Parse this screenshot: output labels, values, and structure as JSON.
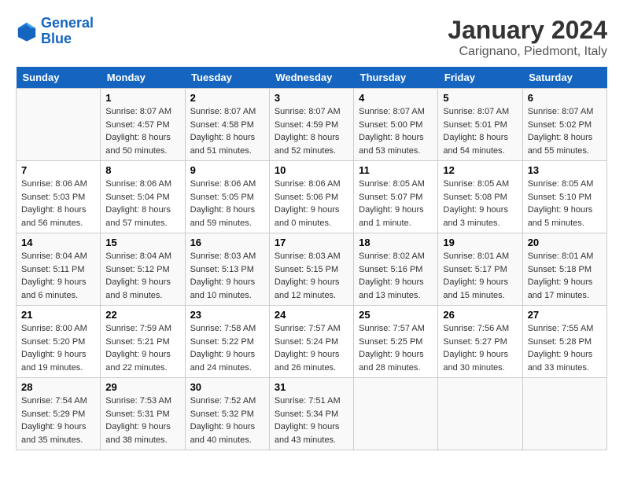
{
  "logo": {
    "line1": "General",
    "line2": "Blue"
  },
  "title": "January 2024",
  "subtitle": "Carignano, Piedmont, Italy",
  "days_of_week": [
    "Sunday",
    "Monday",
    "Tuesday",
    "Wednesday",
    "Thursday",
    "Friday",
    "Saturday"
  ],
  "weeks": [
    [
      {
        "day": "",
        "sunrise": "",
        "sunset": "",
        "daylight": "",
        "empty": true
      },
      {
        "day": "1",
        "sunrise": "Sunrise: 8:07 AM",
        "sunset": "Sunset: 4:57 PM",
        "daylight": "Daylight: 8 hours and 50 minutes."
      },
      {
        "day": "2",
        "sunrise": "Sunrise: 8:07 AM",
        "sunset": "Sunset: 4:58 PM",
        "daylight": "Daylight: 8 hours and 51 minutes."
      },
      {
        "day": "3",
        "sunrise": "Sunrise: 8:07 AM",
        "sunset": "Sunset: 4:59 PM",
        "daylight": "Daylight: 8 hours and 52 minutes."
      },
      {
        "day": "4",
        "sunrise": "Sunrise: 8:07 AM",
        "sunset": "Sunset: 5:00 PM",
        "daylight": "Daylight: 8 hours and 53 minutes."
      },
      {
        "day": "5",
        "sunrise": "Sunrise: 8:07 AM",
        "sunset": "Sunset: 5:01 PM",
        "daylight": "Daylight: 8 hours and 54 minutes."
      },
      {
        "day": "6",
        "sunrise": "Sunrise: 8:07 AM",
        "sunset": "Sunset: 5:02 PM",
        "daylight": "Daylight: 8 hours and 55 minutes."
      }
    ],
    [
      {
        "day": "7",
        "sunrise": "Sunrise: 8:06 AM",
        "sunset": "Sunset: 5:03 PM",
        "daylight": "Daylight: 8 hours and 56 minutes."
      },
      {
        "day": "8",
        "sunrise": "Sunrise: 8:06 AM",
        "sunset": "Sunset: 5:04 PM",
        "daylight": "Daylight: 8 hours and 57 minutes."
      },
      {
        "day": "9",
        "sunrise": "Sunrise: 8:06 AM",
        "sunset": "Sunset: 5:05 PM",
        "daylight": "Daylight: 8 hours and 59 minutes."
      },
      {
        "day": "10",
        "sunrise": "Sunrise: 8:06 AM",
        "sunset": "Sunset: 5:06 PM",
        "daylight": "Daylight: 9 hours and 0 minutes."
      },
      {
        "day": "11",
        "sunrise": "Sunrise: 8:05 AM",
        "sunset": "Sunset: 5:07 PM",
        "daylight": "Daylight: 9 hours and 1 minute."
      },
      {
        "day": "12",
        "sunrise": "Sunrise: 8:05 AM",
        "sunset": "Sunset: 5:08 PM",
        "daylight": "Daylight: 9 hours and 3 minutes."
      },
      {
        "day": "13",
        "sunrise": "Sunrise: 8:05 AM",
        "sunset": "Sunset: 5:10 PM",
        "daylight": "Daylight: 9 hours and 5 minutes."
      }
    ],
    [
      {
        "day": "14",
        "sunrise": "Sunrise: 8:04 AM",
        "sunset": "Sunset: 5:11 PM",
        "daylight": "Daylight: 9 hours and 6 minutes."
      },
      {
        "day": "15",
        "sunrise": "Sunrise: 8:04 AM",
        "sunset": "Sunset: 5:12 PM",
        "daylight": "Daylight: 9 hours and 8 minutes."
      },
      {
        "day": "16",
        "sunrise": "Sunrise: 8:03 AM",
        "sunset": "Sunset: 5:13 PM",
        "daylight": "Daylight: 9 hours and 10 minutes."
      },
      {
        "day": "17",
        "sunrise": "Sunrise: 8:03 AM",
        "sunset": "Sunset: 5:15 PM",
        "daylight": "Daylight: 9 hours and 12 minutes."
      },
      {
        "day": "18",
        "sunrise": "Sunrise: 8:02 AM",
        "sunset": "Sunset: 5:16 PM",
        "daylight": "Daylight: 9 hours and 13 minutes."
      },
      {
        "day": "19",
        "sunrise": "Sunrise: 8:01 AM",
        "sunset": "Sunset: 5:17 PM",
        "daylight": "Daylight: 9 hours and 15 minutes."
      },
      {
        "day": "20",
        "sunrise": "Sunrise: 8:01 AM",
        "sunset": "Sunset: 5:18 PM",
        "daylight": "Daylight: 9 hours and 17 minutes."
      }
    ],
    [
      {
        "day": "21",
        "sunrise": "Sunrise: 8:00 AM",
        "sunset": "Sunset: 5:20 PM",
        "daylight": "Daylight: 9 hours and 19 minutes."
      },
      {
        "day": "22",
        "sunrise": "Sunrise: 7:59 AM",
        "sunset": "Sunset: 5:21 PM",
        "daylight": "Daylight: 9 hours and 22 minutes."
      },
      {
        "day": "23",
        "sunrise": "Sunrise: 7:58 AM",
        "sunset": "Sunset: 5:22 PM",
        "daylight": "Daylight: 9 hours and 24 minutes."
      },
      {
        "day": "24",
        "sunrise": "Sunrise: 7:57 AM",
        "sunset": "Sunset: 5:24 PM",
        "daylight": "Daylight: 9 hours and 26 minutes."
      },
      {
        "day": "25",
        "sunrise": "Sunrise: 7:57 AM",
        "sunset": "Sunset: 5:25 PM",
        "daylight": "Daylight: 9 hours and 28 minutes."
      },
      {
        "day": "26",
        "sunrise": "Sunrise: 7:56 AM",
        "sunset": "Sunset: 5:27 PM",
        "daylight": "Daylight: 9 hours and 30 minutes."
      },
      {
        "day": "27",
        "sunrise": "Sunrise: 7:55 AM",
        "sunset": "Sunset: 5:28 PM",
        "daylight": "Daylight: 9 hours and 33 minutes."
      }
    ],
    [
      {
        "day": "28",
        "sunrise": "Sunrise: 7:54 AM",
        "sunset": "Sunset: 5:29 PM",
        "daylight": "Daylight: 9 hours and 35 minutes."
      },
      {
        "day": "29",
        "sunrise": "Sunrise: 7:53 AM",
        "sunset": "Sunset: 5:31 PM",
        "daylight": "Daylight: 9 hours and 38 minutes."
      },
      {
        "day": "30",
        "sunrise": "Sunrise: 7:52 AM",
        "sunset": "Sunset: 5:32 PM",
        "daylight": "Daylight: 9 hours and 40 minutes."
      },
      {
        "day": "31",
        "sunrise": "Sunrise: 7:51 AM",
        "sunset": "Sunset: 5:34 PM",
        "daylight": "Daylight: 9 hours and 43 minutes."
      },
      {
        "day": "",
        "sunrise": "",
        "sunset": "",
        "daylight": "",
        "empty": true
      },
      {
        "day": "",
        "sunrise": "",
        "sunset": "",
        "daylight": "",
        "empty": true
      },
      {
        "day": "",
        "sunrise": "",
        "sunset": "",
        "daylight": "",
        "empty": true
      }
    ]
  ]
}
